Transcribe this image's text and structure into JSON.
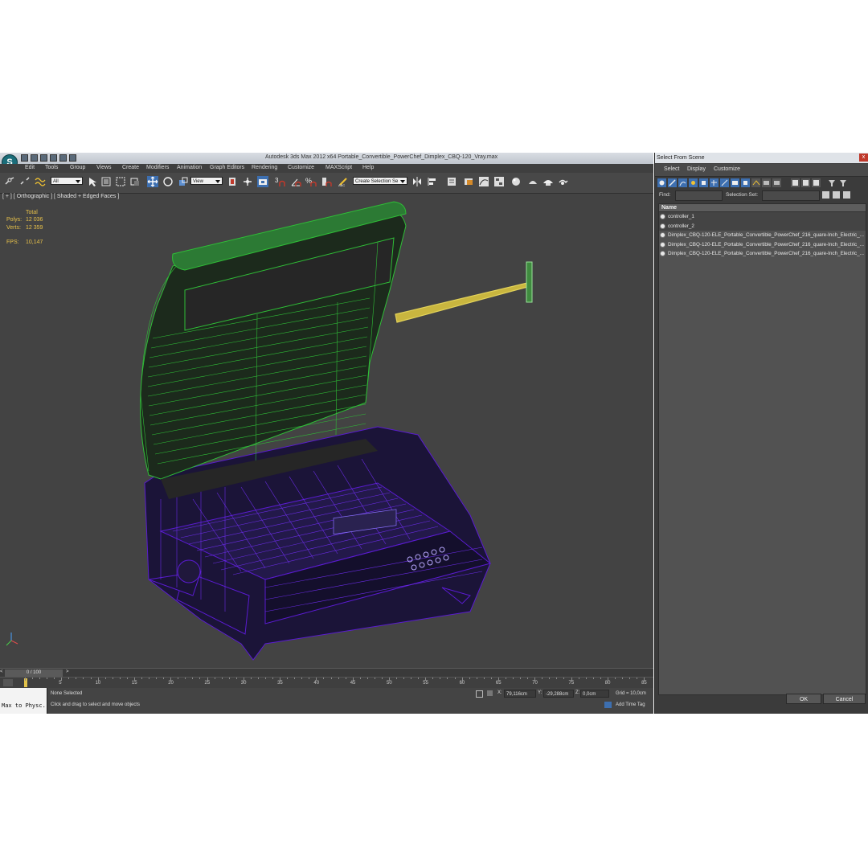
{
  "app": {
    "title": "Autodesk 3ds Max 2012 x64      Portable_Convertible_PowerChef_Dimplex_CBQ-120_Vray.max",
    "menu": [
      "Edit",
      "Tools",
      "Group",
      "Views",
      "Create",
      "Modifiers",
      "Animation",
      "Graph Editors",
      "Rendering",
      "Customize",
      "MAXScript",
      "Help"
    ],
    "logo_letter": "S"
  },
  "toolbar": {
    "selection_filter": "All",
    "reference_coord": "View",
    "named_selection": "Create Selection Se"
  },
  "viewport": {
    "label": "[ + ] [ Orthographic ] [ Shaded + Edged Faces ]",
    "stats_header": "Total",
    "stats": [
      {
        "k": "Polys:",
        "v": "12 036"
      },
      {
        "k": "Verts:",
        "v": "12 359"
      },
      {
        "k": "FPS:",
        "v": "10,147"
      }
    ]
  },
  "timeline": {
    "frame_label": "0 / 100",
    "ticks": [
      "0",
      "5",
      "10",
      "15",
      "20",
      "25",
      "30",
      "35",
      "40",
      "45",
      "50",
      "55",
      "60",
      "65",
      "70",
      "75",
      "80",
      "85"
    ]
  },
  "status": {
    "max_to_physc": "Max to Physc.",
    "selection": "None Selected",
    "prompt": "Click and drag to select and move objects",
    "x_label": "X:",
    "x_value": "79,116cm",
    "y_label": "Y:",
    "y_value": "-29,288cm",
    "z_label": "Z:",
    "z_value": "0,0cm",
    "grid": "Grid = 10,0cm",
    "add_time_tag": "Add Time Tag"
  },
  "dialog": {
    "title": "Select From Scene",
    "close": "x",
    "tabs": [
      "Select",
      "Display",
      "Customize"
    ],
    "find_label": "Find:",
    "selection_set_label": "Selection Set:",
    "column_name": "Name",
    "items": [
      "controller_1",
      "controller_2",
      "Dimplex_CBQ-120-ELE_Portable_Convertible_PowerChef_216_quare-Inch_Electric_...",
      "Dimplex_CBQ-120-ELE_Portable_Convertible_PowerChef_216_quare-Inch_Electric_...",
      "Dimplex_CBQ-120-ELE_Portable_Convertible_PowerChef_216_quare-Inch_Electric_..."
    ],
    "ok": "OK",
    "cancel": "Cancel"
  },
  "colors": {
    "lid_wire": "#2fbe37",
    "base_wire": "#5a1bd1",
    "controller_wire": "#e3d35a"
  }
}
